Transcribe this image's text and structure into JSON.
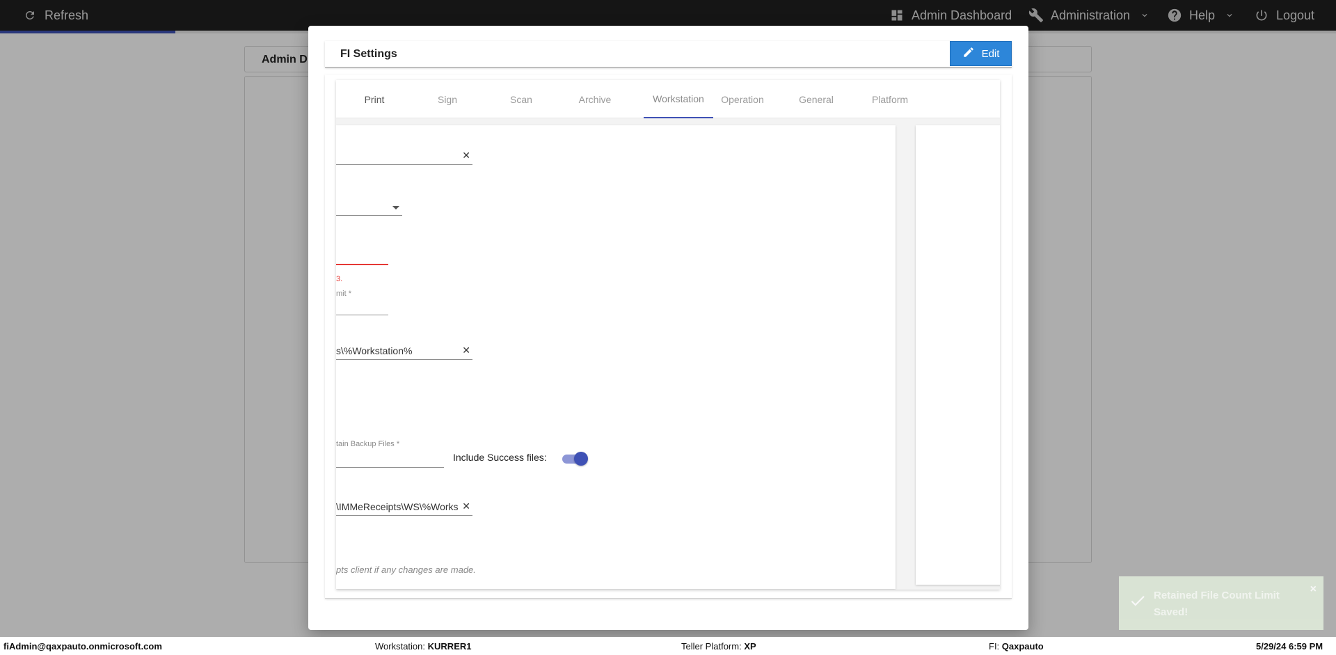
{
  "topbar": {
    "refresh": "Refresh",
    "admin_dashboard": "Admin Dashboard",
    "administration": "Administration",
    "help": "Help",
    "logout": "Logout"
  },
  "background": {
    "header_text": "Admin D"
  },
  "modal": {
    "title": "FI Settings",
    "edit_label": "Edit",
    "tabs": [
      {
        "label": "Print"
      },
      {
        "label": "Sign"
      },
      {
        "label": "Scan"
      },
      {
        "label": "Archive"
      },
      {
        "label": "Workstation"
      },
      {
        "label": "Operation"
      },
      {
        "label": "General"
      },
      {
        "label": "Platform"
      }
    ],
    "active_tab": "Workstation",
    "form": {
      "error_text": "3.",
      "limit_label": "mit *",
      "path_value": "s\\%Workstation%",
      "backup_label": "tain Backup Files *",
      "include_success_label": "Include Success files:",
      "include_success_on": true,
      "receipts_path_value": "\\IMMeReceipts\\WS\\%Works",
      "hint": "pts client if any changes are made."
    }
  },
  "statusbar": {
    "user": "fiAdmin@qaxpauto.onmicrosoft.com",
    "workstation_label": "Workstation:",
    "workstation_value": "KURRER1",
    "platform_label": "Teller Platform:",
    "platform_value": "XP",
    "fi_label": "FI:",
    "fi_value": "Qaxpauto",
    "datetime": "5/29/24 6:59 PM"
  },
  "toast": {
    "message": "Retained File Count Limit Saved!",
    "close": "×"
  },
  "colors": {
    "accent": "#3f51b5",
    "edit_button": "#2d86d9",
    "error": "#e53935",
    "topbar": "#1f1f1f"
  }
}
